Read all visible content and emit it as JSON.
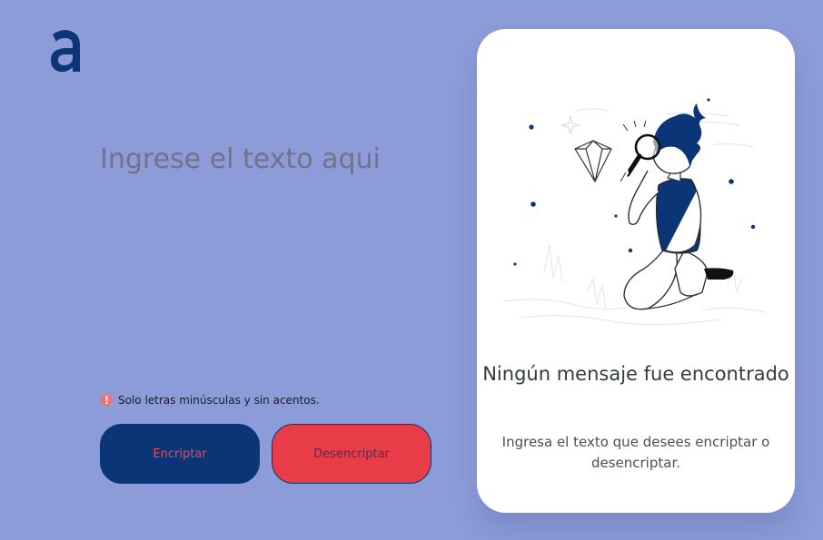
{
  "logo": {
    "icon": "alura-logo-icon",
    "color": "#0b3576"
  },
  "input": {
    "value": "",
    "placeholder": "Ingrese el texto aqui"
  },
  "warning": {
    "icon": "exclamation-circle-icon",
    "text": "Solo letras minúsculas y sin acentos."
  },
  "buttons": {
    "encrypt_label": "Encriptar",
    "decrypt_label": "Desencriptar"
  },
  "result_panel": {
    "illustration": "person-searching-illustration",
    "title": "Ningún mensaje fue encontrado",
    "description": "Ingresa el texto que desees encriptar o desencriptar."
  },
  "colors": {
    "background": "#8b9cd8",
    "primary": "#0b3576",
    "accent": "#e83c48",
    "card": "#ffffff"
  }
}
